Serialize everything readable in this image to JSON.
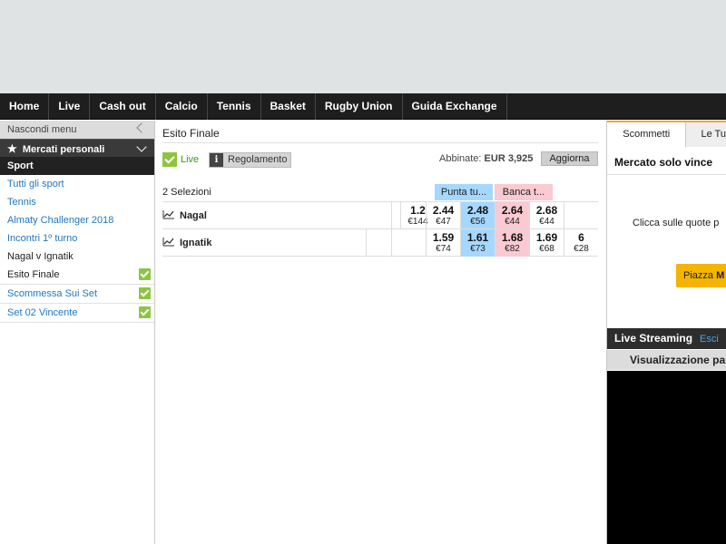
{
  "nav": {
    "items": [
      "Home",
      "Live",
      "Cash out",
      "Calcio",
      "Tennis",
      "Basket",
      "Rugby Union",
      "Guida Exchange"
    ]
  },
  "sidebar": {
    "hide_menu": "Nascondi menu",
    "favourites": "Mercati personali",
    "section": "Sport",
    "links": [
      "Tutti gli sport",
      "Tennis",
      "Almaty Challenger 2018",
      "Incontri 1º turno"
    ],
    "current_event": "Nagal v Ignatik",
    "markets": [
      {
        "label": "Esito Finale",
        "checked": true,
        "style": "dark"
      },
      {
        "label": "Scommessa Sui Set",
        "checked": true,
        "style": "blue"
      },
      {
        "label": "Set 02 Vincente",
        "checked": true,
        "style": "blue"
      }
    ]
  },
  "market": {
    "title": "Esito Finale",
    "live_label": "Live",
    "rules_label": "Regolamento",
    "matched_label": "Abbinate:",
    "matched_value": "EUR 3,925",
    "refresh_label": "Aggiorna",
    "selections_count": "2 Selezioni",
    "back_header": "Punta tu...",
    "lay_header": "Banca t...",
    "runners": [
      {
        "name": "Nagal",
        "cells": [
          {
            "price": "",
            "size": ""
          },
          {
            "price": "1.2",
            "size": "€144"
          },
          {
            "price": "2.44",
            "size": "€47"
          },
          {
            "price": "2.48",
            "size": "€56"
          },
          {
            "price": "2.64",
            "size": "€44"
          },
          {
            "price": "2.68",
            "size": "€44"
          },
          {
            "price": "",
            "size": ""
          }
        ]
      },
      {
        "name": "Ignatik",
        "cells": [
          {
            "price": "",
            "size": ""
          },
          {
            "price": "",
            "size": ""
          },
          {
            "price": "1.59",
            "size": "€74"
          },
          {
            "price": "1.61",
            "size": "€73"
          },
          {
            "price": "1.68",
            "size": "€82"
          },
          {
            "price": "1.69",
            "size": "€68"
          },
          {
            "price": "6",
            "size": "€28"
          }
        ]
      }
    ]
  },
  "betslip": {
    "tab_active": "Scommetti",
    "tab_other": "Le Tu",
    "market_text": "Mercato solo vince",
    "hint": "Clicca sulle quote p",
    "place_prefix": "Piazza",
    "place_bold": "M",
    "streaming_label": "Live Streaming",
    "exit_label": "Esci",
    "visualization": "Visualizzazione par"
  },
  "colors": {
    "back": "#a6d8ff",
    "lay": "#fac9d1",
    "accent": "#f5b400",
    "check": "#8cc63f",
    "nav_bg": "#1e1e1e"
  }
}
